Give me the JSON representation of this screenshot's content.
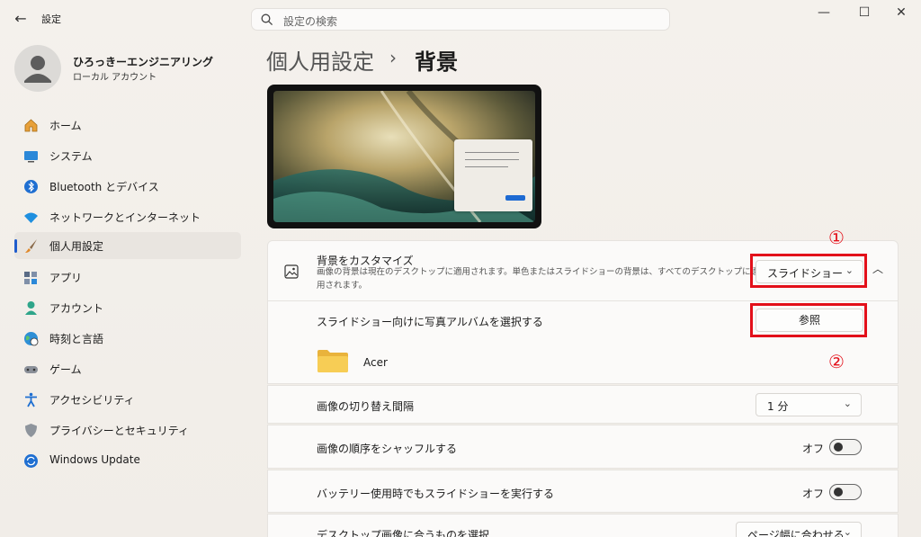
{
  "titlebar": {
    "back": "←",
    "title": "設定",
    "minimize": "—",
    "maximize": "☐",
    "close": "✕"
  },
  "search": {
    "placeholder": "設定の検索"
  },
  "profile": {
    "name": "ひろっきーエンジニアリング",
    "account": "ローカル アカウント"
  },
  "nav": [
    {
      "label": "ホーム",
      "icon": "home-icon"
    },
    {
      "label": "システム",
      "icon": "system-icon"
    },
    {
      "label": "Bluetooth とデバイス",
      "icon": "bluetooth-icon"
    },
    {
      "label": "ネットワークとインターネット",
      "icon": "wifi-icon"
    },
    {
      "label": "個人用設定",
      "icon": "brush-icon",
      "active": true
    },
    {
      "label": "アプリ",
      "icon": "apps-icon"
    },
    {
      "label": "アカウント",
      "icon": "account-icon"
    },
    {
      "label": "時刻と言語",
      "icon": "globe-clock-icon"
    },
    {
      "label": "ゲーム",
      "icon": "gamepad-icon"
    },
    {
      "label": "アクセシビリティ",
      "icon": "accessibility-icon"
    },
    {
      "label": "プライバシーとセキュリティ",
      "icon": "shield-icon"
    },
    {
      "label": "Windows Update",
      "icon": "update-icon"
    }
  ],
  "breadcrumb": {
    "parent": "個人用設定",
    "separator": "›",
    "current": "背景"
  },
  "background": {
    "title": "背景をカスタマイズ",
    "desc_line1": "画像の背景は現在のデスクトップに適用されます。単色またはスライドショーの背景は、すべてのデスクトップに適",
    "desc_line2": "用されます。",
    "dropdown_value": "スライドショー",
    "chevron": "⌄",
    "expand": "︿"
  },
  "album": {
    "label": "スライドショー向けに写真アルバムを選択する",
    "browse": "参照",
    "folder": "Acer"
  },
  "interval": {
    "label": "画像の切り替え間隔",
    "value": "1 分"
  },
  "shuffle": {
    "label": "画像の順序をシャッフルする",
    "state": "オフ"
  },
  "battery": {
    "label": "バッテリー使用時でもスライドショーを実行する",
    "state": "オフ"
  },
  "fit": {
    "label": "デスクトップ画像に合うものを選択",
    "value": "ページ幅に合わせる"
  },
  "annotations": {
    "one": "①",
    "two": "②"
  },
  "colors": {
    "accent": "#1f5ccc",
    "annotation": "#e3101a"
  }
}
